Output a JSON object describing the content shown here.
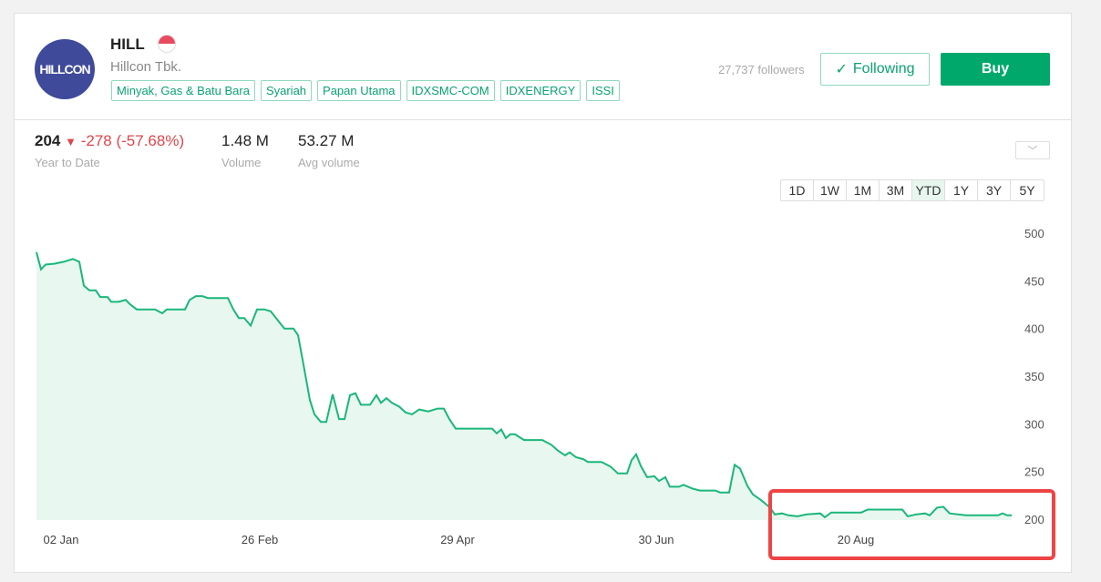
{
  "header": {
    "logo_text": "HILLCON",
    "ticker": "HILL",
    "company": "Hillcon Tbk.",
    "tags": [
      "Minyak, Gas & Batu Bara",
      "Syariah",
      "Papan Utama",
      "IDXSMC-COM",
      "IDXENERGY",
      "ISSI"
    ],
    "followers": "27,737 followers",
    "following_label": "Following",
    "buy_label": "Buy"
  },
  "stats": {
    "price": "204",
    "change": "-278 (-57.68%)",
    "period_label": "Year to Date",
    "volume": "1.48 M",
    "volume_label": "Volume",
    "avg_volume": "53.27 M",
    "avg_volume_label": "Avg volume"
  },
  "ranges": [
    "1D",
    "1W",
    "1M",
    "3M",
    "YTD",
    "1Y",
    "3Y",
    "5Y"
  ],
  "active_range": "YTD",
  "colors": {
    "line": "#1ab77a",
    "fill": "#e8f7f0",
    "accent": "#00a86b",
    "down": "#e0454a",
    "highlight": "#ee4444"
  },
  "chart_data": {
    "type": "area",
    "ylim": [
      200,
      500
    ],
    "yticks": [
      500,
      450,
      400,
      350,
      300,
      250,
      200
    ],
    "xlim": [
      0,
      535
    ],
    "xticks": [
      {
        "x": 13.5,
        "label": "02 Jan"
      },
      {
        "x": 122.5,
        "label": "26 Feb"
      },
      {
        "x": 231,
        "label": "29 Apr"
      },
      {
        "x": 340,
        "label": "30 Jun"
      },
      {
        "x": 449.5,
        "label": "20 Aug"
      }
    ],
    "points": [
      [
        0,
        480
      ],
      [
        2.5,
        462
      ],
      [
        5,
        467
      ],
      [
        10,
        468
      ],
      [
        15,
        470
      ],
      [
        20,
        473
      ],
      [
        23.5,
        470
      ],
      [
        26,
        445
      ],
      [
        29,
        440
      ],
      [
        32.5,
        440
      ],
      [
        35,
        433
      ],
      [
        39,
        433
      ],
      [
        41,
        428
      ],
      [
        45,
        428
      ],
      [
        49,
        430
      ],
      [
        51,
        426
      ],
      [
        55,
        420
      ],
      [
        65,
        420
      ],
      [
        69,
        416
      ],
      [
        71.5,
        420
      ],
      [
        81.5,
        420
      ],
      [
        84,
        430
      ],
      [
        87.5,
        434
      ],
      [
        91,
        434
      ],
      [
        94,
        432
      ],
      [
        105,
        432
      ],
      [
        108,
        420
      ],
      [
        111,
        411
      ],
      [
        114,
        411
      ],
      [
        117.5,
        403
      ],
      [
        121,
        420
      ],
      [
        125,
        420
      ],
      [
        128.5,
        418
      ],
      [
        131,
        412
      ],
      [
        136,
        400
      ],
      [
        141,
        400
      ],
      [
        143.5,
        393
      ],
      [
        146.5,
        362
      ],
      [
        150,
        325
      ],
      [
        152.5,
        310
      ],
      [
        156,
        302
      ],
      [
        159,
        302
      ],
      [
        162.5,
        331
      ],
      [
        166,
        305
      ],
      [
        169,
        305
      ],
      [
        172,
        330
      ],
      [
        175,
        332
      ],
      [
        178,
        320
      ],
      [
        183,
        320
      ],
      [
        186.5,
        330
      ],
      [
        189,
        322
      ],
      [
        192,
        327
      ],
      [
        195,
        322
      ],
      [
        199,
        318
      ],
      [
        202.5,
        312
      ],
      [
        206,
        310
      ],
      [
        210,
        315
      ],
      [
        215,
        313
      ],
      [
        220,
        316
      ],
      [
        223.5,
        316
      ],
      [
        226.5,
        305
      ],
      [
        230,
        295
      ],
      [
        250,
        295
      ],
      [
        252.5,
        290
      ],
      [
        255,
        294
      ],
      [
        257.5,
        285
      ],
      [
        260,
        289
      ],
      [
        262.5,
        289
      ],
      [
        265,
        286
      ],
      [
        267.5,
        283
      ],
      [
        277.5,
        283
      ],
      [
        282.5,
        278
      ],
      [
        286,
        272
      ],
      [
        290,
        267
      ],
      [
        292.5,
        270
      ],
      [
        296,
        265
      ],
      [
        300,
        263
      ],
      [
        302.5,
        260
      ],
      [
        310,
        260
      ],
      [
        315,
        255
      ],
      [
        319,
        248
      ],
      [
        324,
        248
      ],
      [
        326.5,
        262
      ],
      [
        329,
        268
      ],
      [
        331.5,
        256
      ],
      [
        335,
        244
      ],
      [
        339,
        245
      ],
      [
        341.5,
        240
      ],
      [
        345,
        244
      ],
      [
        347.5,
        234
      ],
      [
        352.5,
        234
      ],
      [
        355,
        236
      ],
      [
        360,
        232
      ],
      [
        364,
        230
      ],
      [
        372.5,
        230
      ],
      [
        375,
        228
      ],
      [
        380,
        228
      ],
      [
        383,
        257
      ],
      [
        386,
        253
      ],
      [
        390,
        235
      ],
      [
        393,
        226
      ],
      [
        397.5,
        220
      ],
      [
        402.5,
        212
      ],
      [
        405,
        205
      ],
      [
        409,
        206
      ],
      [
        412.5,
        204
      ],
      [
        417.5,
        203
      ],
      [
        422.5,
        205
      ],
      [
        430,
        206
      ],
      [
        432.5,
        202
      ],
      [
        436,
        207
      ],
      [
        452.5,
        207
      ],
      [
        456,
        210
      ],
      [
        475,
        210
      ],
      [
        478,
        203
      ],
      [
        482.5,
        205
      ],
      [
        487.5,
        206
      ],
      [
        490,
        204
      ],
      [
        494,
        212
      ],
      [
        497.5,
        213
      ],
      [
        501,
        206
      ],
      [
        510,
        204
      ],
      [
        527.5,
        204
      ],
      [
        530,
        206
      ],
      [
        532.5,
        204
      ],
      [
        535,
        204
      ]
    ]
  }
}
